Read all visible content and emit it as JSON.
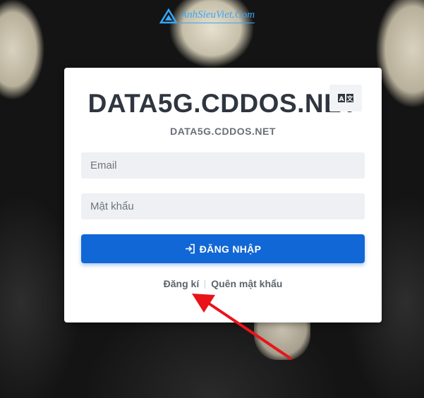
{
  "logo": {
    "text": "AnhSieuViet.Com"
  },
  "card": {
    "title": "DATA5G.CDDOS.NET",
    "subtitle": "DATA5G.CDDOS.NET"
  },
  "form": {
    "email_placeholder": "Email",
    "password_placeholder": "Mật khẩu",
    "login_label": "ĐĂNG NHẬP"
  },
  "links": {
    "register": "Đăng kí",
    "forgot": "Quên mật khẩu"
  },
  "colors": {
    "primary": "#1167d6",
    "annotation_arrow": "#e8141a"
  },
  "icons": {
    "login": "sign-in-icon",
    "translate": "translate-icon",
    "logo": "triangle-logo-icon"
  }
}
